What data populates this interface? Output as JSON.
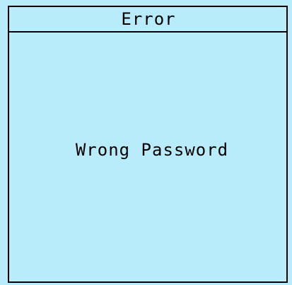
{
  "dialog": {
    "title": "Error",
    "message": "Wrong Password"
  },
  "colors": {
    "background": "#b9ecfb",
    "border": "#000000",
    "text": "#000000"
  }
}
